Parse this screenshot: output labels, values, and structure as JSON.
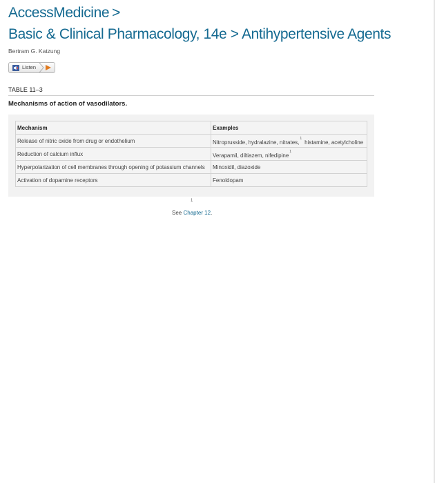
{
  "breadcrumb": {
    "site": "AccessMedicine",
    "separator": ">"
  },
  "page": {
    "book": "Basic & Clinical Pharmacology, 14e",
    "separator": ">",
    "chapter": "Antihypertensive Agents",
    "author": "Bertram G. Katzung"
  },
  "listen_button": {
    "label": "Listen",
    "speaker_icon": "speaker-icon",
    "play_icon": "play-icon",
    "accent_color": "#e07a1f"
  },
  "table": {
    "label": "TABLE 11–3",
    "caption": "Mechanisms of action of vasodilators.",
    "headers": [
      "Mechanism",
      "Examples"
    ],
    "rows": [
      {
        "mechanism": "Release of nitric oxide from drug or endothelium",
        "examples_a": "Nitroprusside, hydralazine, nitrates,",
        "footnote": "1",
        "examples_b": "histamine, acetylcholine"
      },
      {
        "mechanism": "Reduction of calcium influx",
        "examples_a": "Verapamil, diltiazem, nifedipine",
        "footnote": "1",
        "examples_b": ""
      },
      {
        "mechanism": "Hyperpolarization of cell membranes through opening of potassium channels",
        "examples_a": "Minoxidil, diazoxide",
        "footnote": "",
        "examples_b": ""
      },
      {
        "mechanism": "Activation of dopamine receptors",
        "examples_a": "Fenoldopam",
        "footnote": "",
        "examples_b": ""
      }
    ]
  },
  "footnote": {
    "mark": "1",
    "prefix": "See",
    "link": "Chapter 12",
    "suffix": "."
  },
  "colors": {
    "link": "#156a91",
    "panel": "#f2f2f2"
  }
}
